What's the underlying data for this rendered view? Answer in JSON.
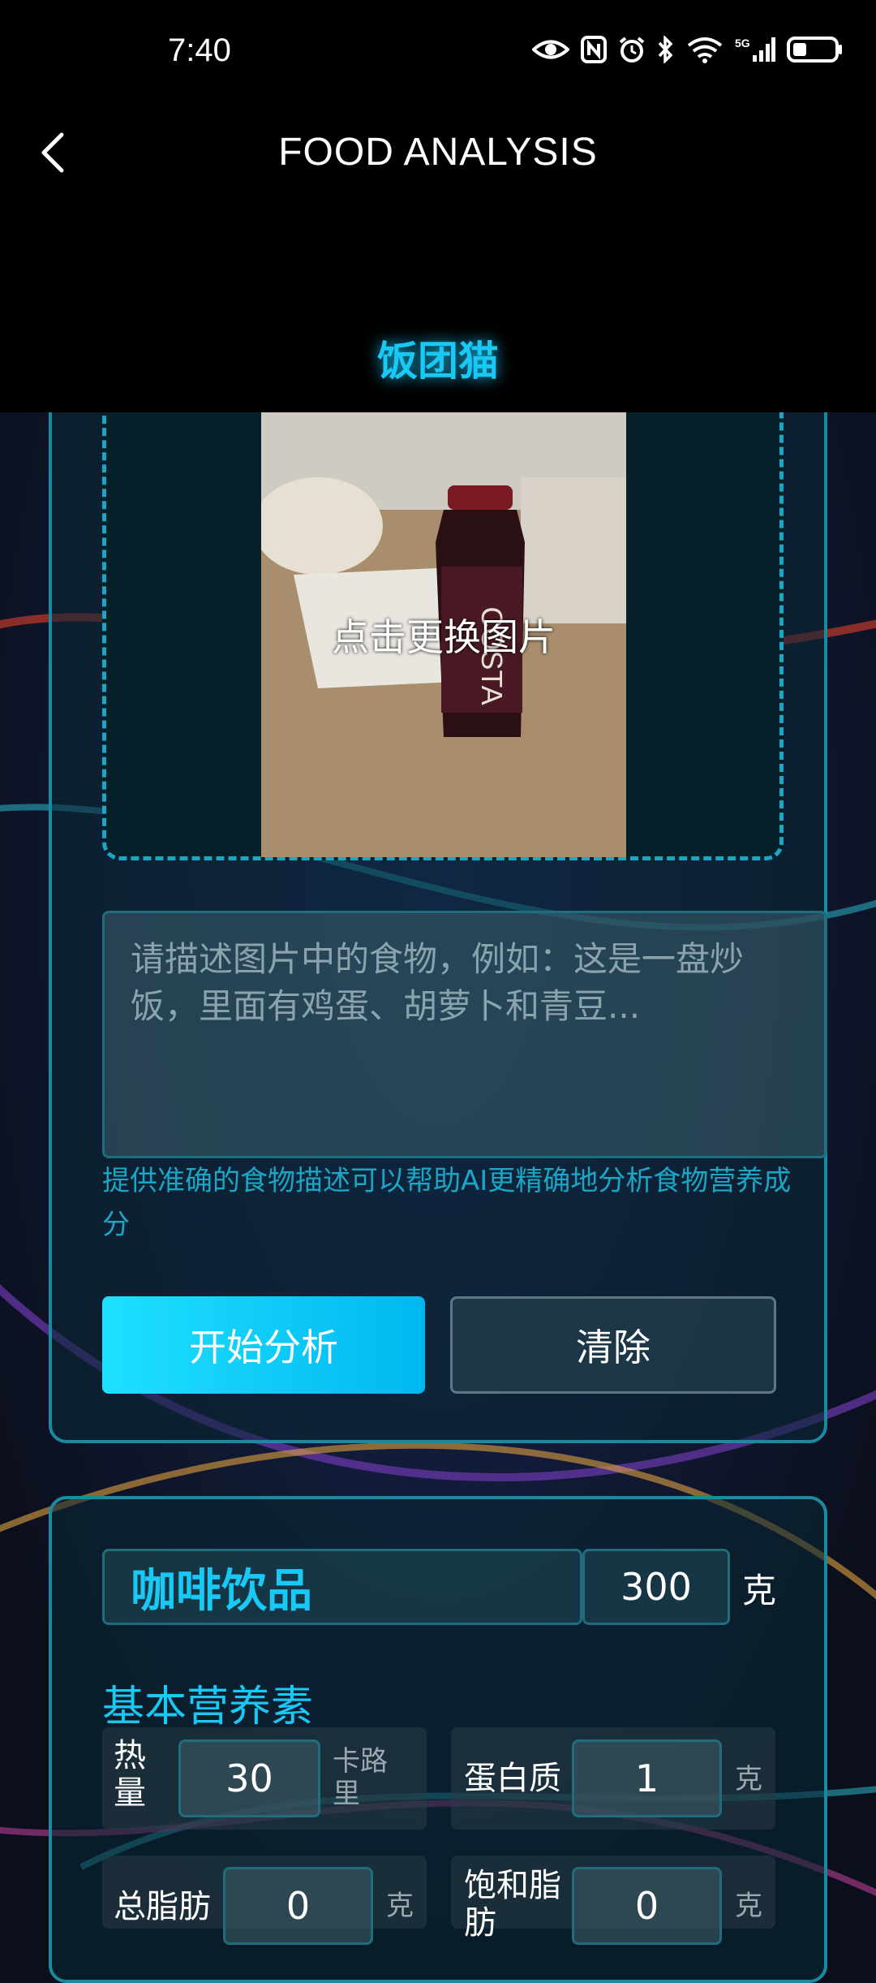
{
  "status": {
    "time": "7:40"
  },
  "header": {
    "title": "FOOD ANALYSIS",
    "brand": "饭团猫"
  },
  "upload": {
    "overlay_text": "点击更换图片"
  },
  "description": {
    "placeholder": "请描述图片中的食物，例如：这是一盘炒饭，里面有鸡蛋、胡萝卜和青豆...",
    "hint": "提供准确的食物描述可以帮助AI更精确地分析食物营养成分"
  },
  "buttons": {
    "analyze": "开始分析",
    "clear": "清除"
  },
  "result": {
    "food_name": "咖啡饮品",
    "weight": "300",
    "weight_unit": "克",
    "section_title": "基本营养素",
    "nutrients": [
      {
        "label": "热量",
        "value": "30",
        "unit": "卡路里"
      },
      {
        "label": "蛋白质",
        "value": "1",
        "unit": "克"
      },
      {
        "label": "总脂肪",
        "value": "0",
        "unit": "克"
      },
      {
        "label": "饱和脂肪",
        "value": "0",
        "unit": "克"
      }
    ]
  },
  "colors": {
    "accent": "#18c8f5",
    "border": "#1a8aa0",
    "background": "#0b0f1c"
  }
}
